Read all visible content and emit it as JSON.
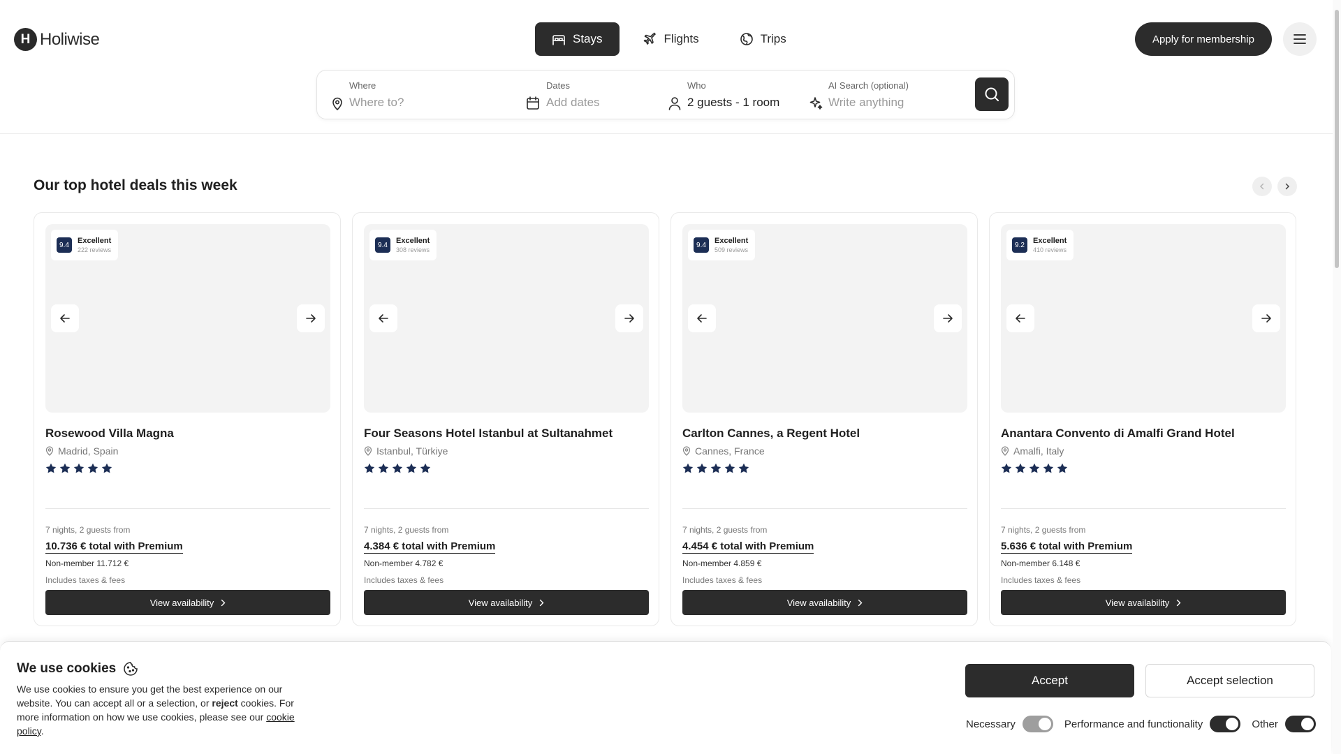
{
  "header": {
    "logo_letter": "H",
    "logo_text": "Holiwise",
    "tabs": [
      {
        "label": "Stays",
        "icon": "bed-icon",
        "active": true
      },
      {
        "label": "Flights",
        "icon": "plane-icon",
        "active": false
      },
      {
        "label": "Trips",
        "icon": "globe-icon",
        "active": false
      }
    ],
    "apply_label": "Apply for membership",
    "menu_icon": "hamburger-icon"
  },
  "search": {
    "where_label": "Where",
    "where_placeholder": "Where to?",
    "dates_label": "Dates",
    "dates_placeholder": "Add dates",
    "who_label": "Who",
    "who_value": "2 guests - 1 room",
    "ai_label": "AI Search (optional)",
    "ai_placeholder": "Write anything"
  },
  "section": {
    "title": "Our top hotel deals this week"
  },
  "cards": [
    {
      "score": "9.4",
      "rating_word": "Excellent",
      "reviews": "222 reviews",
      "name": "Rosewood Villa Magna",
      "location": "Madrid, Spain",
      "stars": 5,
      "nights": "7 nights, 2 guests from",
      "total": "10.736 € total with Premium",
      "nonmember": "Non-member 11.712 €",
      "taxes": "Includes taxes & fees",
      "cta": "View availability"
    },
    {
      "score": "9.4",
      "rating_word": "Excellent",
      "reviews": "308 reviews",
      "name": "Four Seasons Hotel Istanbul at Sultanahmet",
      "location": "Istanbul, Türkiye",
      "stars": 5,
      "nights": "7 nights, 2 guests from",
      "total": "4.384 € total with Premium",
      "nonmember": "Non-member 4.782 €",
      "taxes": "Includes taxes & fees",
      "cta": "View availability"
    },
    {
      "score": "9.4",
      "rating_word": "Excellent",
      "reviews": "509 reviews",
      "name": "Carlton Cannes, a Regent Hotel",
      "location": "Cannes, France",
      "stars": 5,
      "nights": "7 nights, 2 guests from",
      "total": "4.454 € total with Premium",
      "nonmember": "Non-member 4.859 €",
      "taxes": "Includes taxes & fees",
      "cta": "View availability"
    },
    {
      "score": "9.2",
      "rating_word": "Excellent",
      "reviews": "410 reviews",
      "name": "Anantara Convento di Amalfi Grand Hotel",
      "location": "Amalfi, Italy",
      "stars": 5,
      "nights": "7 nights, 2 guests from",
      "total": "5.636 € total with Premium",
      "nonmember": "Non-member 6.148 €",
      "taxes": "Includes taxes & fees",
      "cta": "View availability"
    }
  ],
  "cookie": {
    "title": "We use cookies",
    "text_1": "We use cookies to ensure you get the best experience on our website. You can accept all or a selection, or ",
    "text_reject": "reject",
    "text_2": " cookies. For more information on how we use cookies, please see our ",
    "policy_link": "cookie policy",
    "text_end": ".",
    "accept_label": "Accept",
    "accept_selection_label": "Accept selection",
    "toggles": [
      {
        "label": "Necessary",
        "state": "on-disabled"
      },
      {
        "label": "Performance and functionality",
        "state": "on"
      },
      {
        "label": "Other",
        "state": "on"
      }
    ]
  },
  "colors": {
    "primary_dark": "#2c2c2c",
    "rating_navy": "#1c2e55",
    "star_navy": "#1c2e55"
  }
}
